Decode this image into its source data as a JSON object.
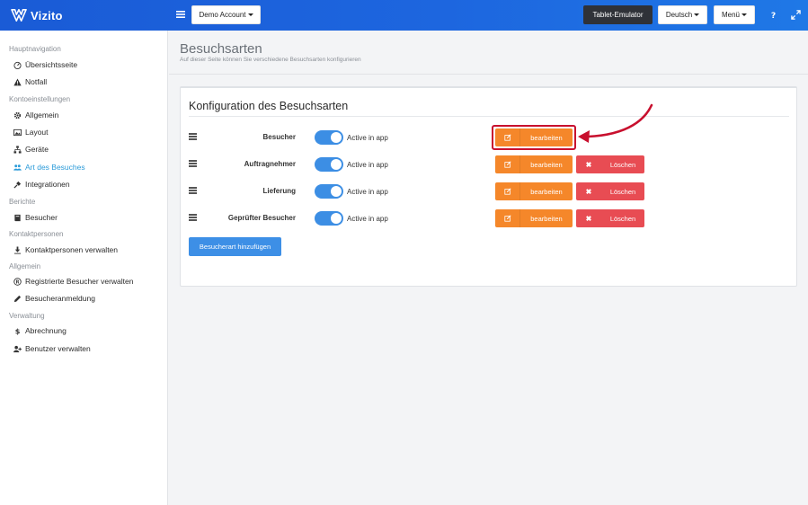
{
  "app": {
    "name": "Vizito"
  },
  "topbar": {
    "account_label": "Demo Account",
    "tablet_label": "Tablet-Emulator",
    "language_label": "Deutsch",
    "menu_label": "Menü",
    "icons": [
      "menu-icon",
      "help-icon",
      "expand-icon"
    ]
  },
  "sidebar": {
    "sections": [
      {
        "title": "Hauptnavigation",
        "items": [
          {
            "label": "Übersichtsseite",
            "icon": "dashboard-icon"
          },
          {
            "label": "Notfall",
            "icon": "warning-icon"
          }
        ]
      },
      {
        "title": "Kontoeinstellungen",
        "items": [
          {
            "label": "Allgemein",
            "icon": "gear-icon"
          },
          {
            "label": "Layout",
            "icon": "image-icon"
          },
          {
            "label": "Geräte",
            "icon": "sitemap-icon"
          },
          {
            "label": "Art des Besuches",
            "icon": "users-icon",
            "active": true
          },
          {
            "label": "Integrationen",
            "icon": "plug-icon"
          }
        ]
      },
      {
        "title": "Berichte",
        "items": [
          {
            "label": "Besucher",
            "icon": "book-icon"
          }
        ]
      },
      {
        "title": "Kontaktpersonen",
        "items": [
          {
            "label": "Kontaktpersonen verwalten",
            "icon": "person-icon"
          }
        ]
      },
      {
        "title": "Allgemein",
        "items": [
          {
            "label": "Registrierte Besucher verwalten",
            "icon": "registered-icon"
          },
          {
            "label": "Besucheranmeldung",
            "icon": "pencil-icon"
          }
        ]
      },
      {
        "title": "Verwaltung",
        "items": [
          {
            "label": "Abrechnung",
            "icon": "dollar-icon"
          },
          {
            "label": "Benutzer verwalten",
            "icon": "user-plus-icon"
          }
        ]
      }
    ]
  },
  "page": {
    "title": "Besuchsarten",
    "subtitle": "Auf dieser Seite können Sie verschiedene Besuchsarten konfigurieren"
  },
  "card": {
    "title": "Konfiguration des Besuchsarten",
    "toggle_label": "Active in app",
    "edit_label": "bearbeiten",
    "delete_label": "Löschen",
    "add_label": "Besucherart hinzufügen",
    "rows": [
      {
        "name": "Besucher",
        "active": true,
        "deletable": false,
        "highlighted": true
      },
      {
        "name": "Auftragnehmer",
        "active": true,
        "deletable": true
      },
      {
        "name": "Lieferung",
        "active": true,
        "deletable": true
      },
      {
        "name": "Geprüfter Besucher",
        "active": true,
        "deletable": true
      }
    ]
  },
  "colors": {
    "topbar": "#1d66df",
    "accent_active": "#2b9bd9",
    "edit_button": "#f5872a",
    "delete_button": "#e84c53",
    "primary_button": "#3d8fe6",
    "highlight": "#c8102e"
  }
}
